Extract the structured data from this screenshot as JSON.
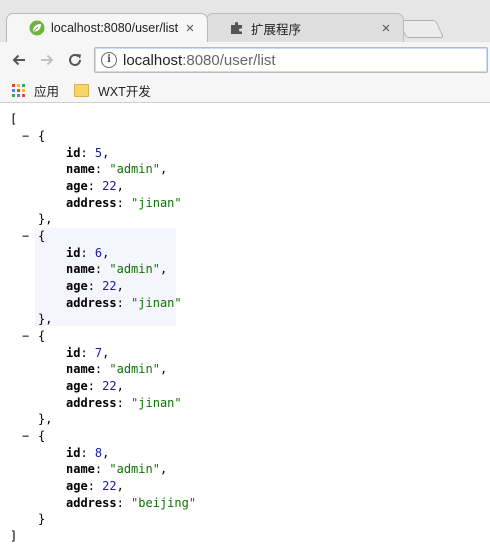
{
  "tabs": [
    {
      "title": "localhost:8080/user/list",
      "close": "×",
      "favicon": "spring-leaf-icon",
      "active": true
    },
    {
      "title": "扩展程序",
      "close": "×",
      "favicon": "puzzle-icon",
      "active": false
    }
  ],
  "toolbar": {
    "back": "back-arrow-icon",
    "forward": "forward-arrow-icon",
    "reload": "reload-icon",
    "url_host": "localhost",
    "url_path": ":8080/user/list"
  },
  "bookmarks": [
    {
      "label": "应用",
      "icon": "apps-grid-icon"
    },
    {
      "label": "WXT开发",
      "icon": "folder-icon"
    }
  ],
  "json": {
    "open_bracket": "[",
    "close_bracket": "]",
    "collapse": "−",
    "open_brace": "{",
    "close_brace_comma": "},",
    "close_brace": "}",
    "records": [
      {
        "id": "5",
        "name": "admin",
        "age": "22",
        "address": "jinan"
      },
      {
        "id": "6",
        "name": "admin",
        "age": "22",
        "address": "jinan"
      },
      {
        "id": "7",
        "name": "admin",
        "age": "22",
        "address": "jinan"
      },
      {
        "id": "8",
        "name": "admin",
        "age": "22",
        "address": "beijing"
      }
    ]
  },
  "colors": {
    "number": "#1a1aa6",
    "string": "#0b7500",
    "hover_highlight": "#f5f6fd"
  }
}
